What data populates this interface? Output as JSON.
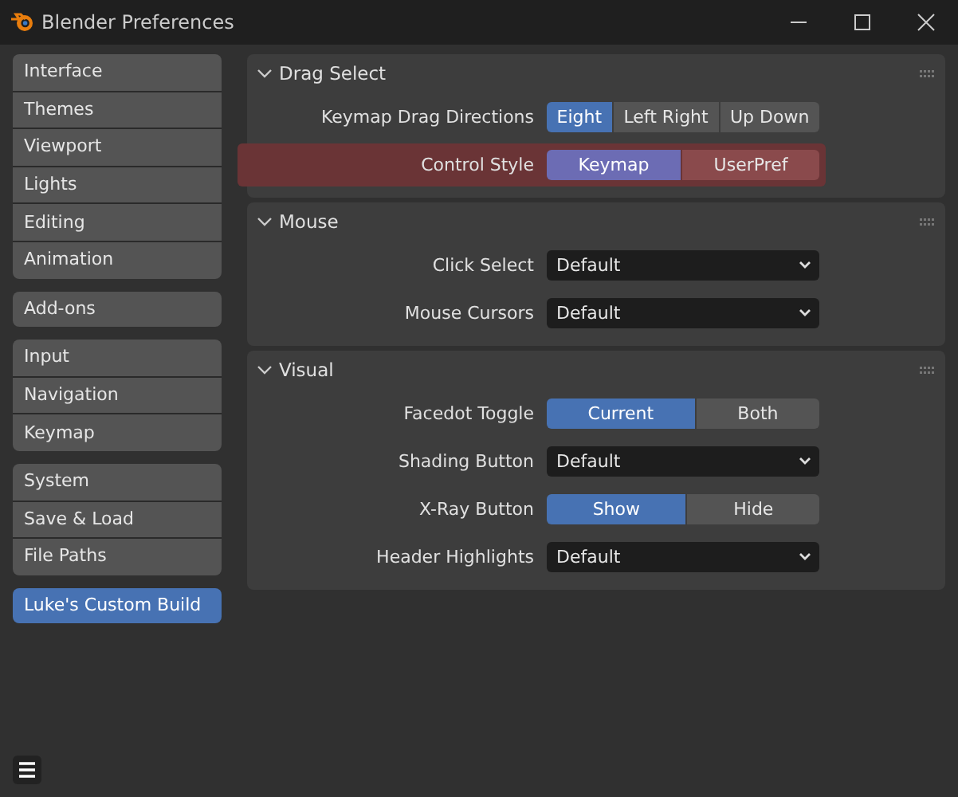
{
  "window": {
    "title": "Blender Preferences"
  },
  "sidebar": {
    "groups": [
      [
        {
          "label": "Interface",
          "selected": false
        },
        {
          "label": "Themes",
          "selected": false
        },
        {
          "label": "Viewport",
          "selected": false
        },
        {
          "label": "Lights",
          "selected": false
        },
        {
          "label": "Editing",
          "selected": false
        },
        {
          "label": "Animation",
          "selected": false
        }
      ],
      [
        {
          "label": "Add-ons",
          "selected": false
        }
      ],
      [
        {
          "label": "Input",
          "selected": false
        },
        {
          "label": "Navigation",
          "selected": false
        },
        {
          "label": "Keymap",
          "selected": false
        }
      ],
      [
        {
          "label": "System",
          "selected": false
        },
        {
          "label": "Save & Load",
          "selected": false
        },
        {
          "label": "File Paths",
          "selected": false
        }
      ],
      [
        {
          "label": "Luke's Custom Build",
          "selected": true
        }
      ]
    ]
  },
  "panels": [
    {
      "title": "Drag Select",
      "expanded": true,
      "rows": [
        {
          "kind": "enum",
          "label": "Keymap Drag Directions",
          "highlighted": false,
          "options": [
            {
              "label": "Eight",
              "selected": true
            },
            {
              "label": "Left Right",
              "selected": false
            },
            {
              "label": "Up Down",
              "selected": false
            }
          ]
        },
        {
          "kind": "enum",
          "label": "Control Style",
          "highlighted": true,
          "options": [
            {
              "label": "Keymap",
              "selected": true
            },
            {
              "label": "UserPref",
              "selected": false
            }
          ]
        }
      ]
    },
    {
      "title": "Mouse",
      "expanded": true,
      "rows": [
        {
          "kind": "dropdown",
          "label": "Click Select",
          "value": "Default"
        },
        {
          "kind": "dropdown",
          "label": "Mouse Cursors",
          "value": "Default"
        }
      ]
    },
    {
      "title": "Visual",
      "expanded": true,
      "rows": [
        {
          "kind": "enum",
          "label": "Facedot Toggle",
          "highlighted": false,
          "options": [
            {
              "label": "Current",
              "selected": true
            },
            {
              "label": "Both",
              "selected": false
            }
          ]
        },
        {
          "kind": "dropdown",
          "label": "Shading Button",
          "value": "Default"
        },
        {
          "kind": "enum",
          "label": "X-Ray Button",
          "highlighted": false,
          "options": [
            {
              "label": "Show",
              "selected": true
            },
            {
              "label": "Hide",
              "selected": false
            }
          ]
        },
        {
          "kind": "dropdown",
          "label": "Header Highlights",
          "value": "Default"
        }
      ]
    }
  ]
}
